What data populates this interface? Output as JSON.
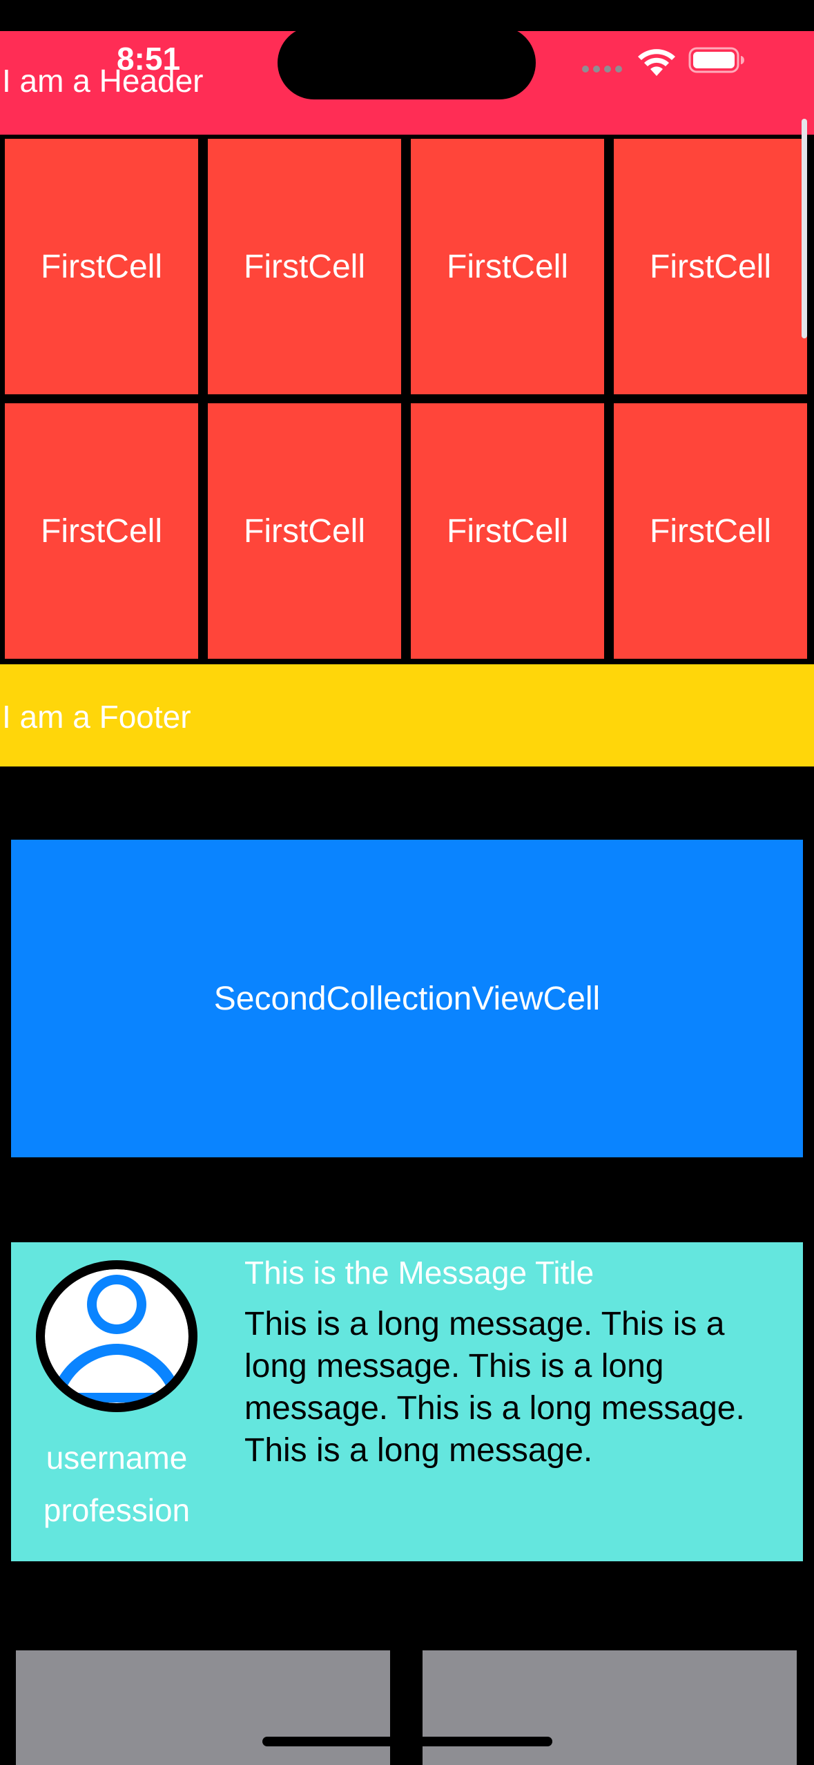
{
  "status_bar": {
    "time": "8:51",
    "icons": [
      "signal-dots-icon",
      "wifi-icon",
      "battery-icon"
    ]
  },
  "header": {
    "label": "I am a Header",
    "color": "#FF2D55"
  },
  "first_collection": {
    "cell_color": "#FF453A",
    "cells": [
      {
        "label": "FirstCell"
      },
      {
        "label": "FirstCell"
      },
      {
        "label": "FirstCell"
      },
      {
        "label": "FirstCell"
      },
      {
        "label": "FirstCell"
      },
      {
        "label": "FirstCell"
      },
      {
        "label": "FirstCell"
      },
      {
        "label": "FirstCell"
      }
    ]
  },
  "footer": {
    "label": "I am a Footer",
    "color": "#FFD60A"
  },
  "second_collection": {
    "label": "SecondCollectionViewCell",
    "color": "#0A84FF"
  },
  "message_cell": {
    "color": "#64E6DE",
    "avatar_icon": "person-circle-icon",
    "username": "username",
    "profession": "profession",
    "title": "This is the Message Title",
    "body": "This is a long message. This is a long message. This is a long message. This is a long message. This is a long message."
  },
  "bottom_cells": {
    "color": "#8E8E93",
    "count": 2
  }
}
